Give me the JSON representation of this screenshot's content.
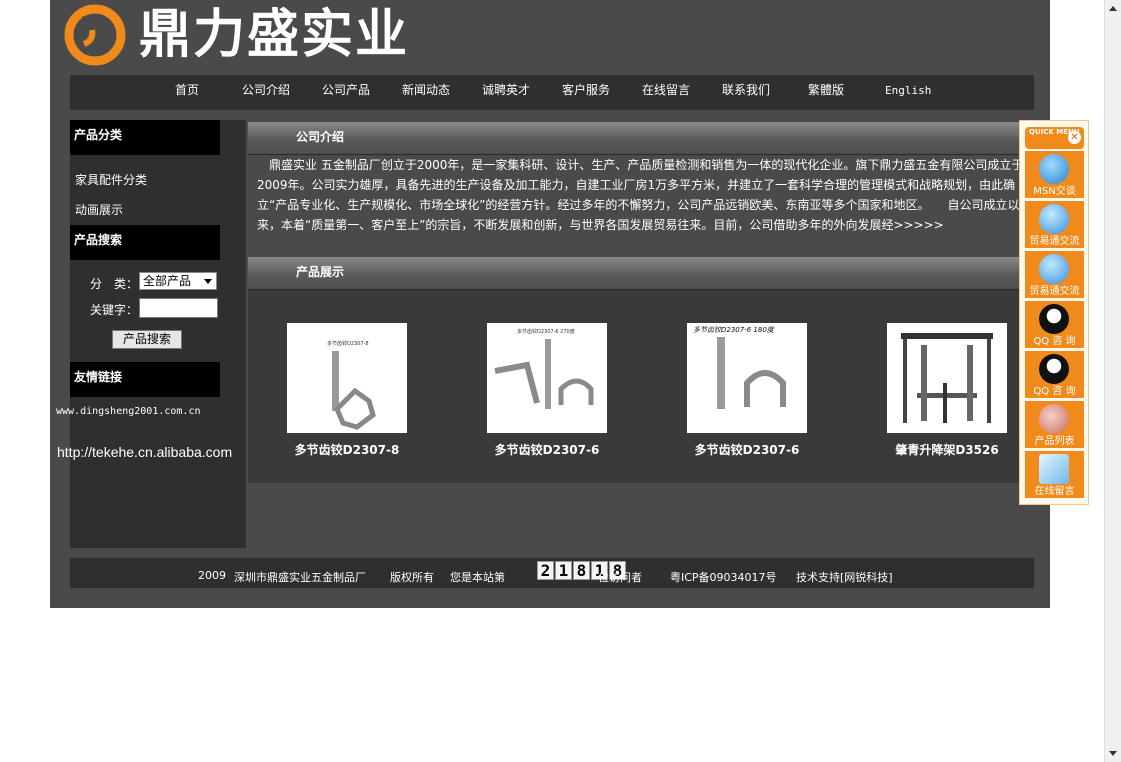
{
  "header": {
    "logo_text": "鼎力盛实业"
  },
  "nav": [
    "首页",
    "公司介绍",
    "公司产品",
    "新闻动态",
    "诚聘英才",
    "客户服务",
    "在线留言",
    "联系我们",
    "繁體版",
    "English"
  ],
  "sidebar": {
    "category_title": "产品分类",
    "categories": [
      "家具配件分类",
      "动画展示"
    ],
    "search_title": "产品搜索",
    "category_label": "分　类：",
    "category_value": "全部产品",
    "keyword_label": "关键字：",
    "search_button": "产品搜索",
    "links_title": "友情链接",
    "links": [
      "www.dingsheng2001.com.cn",
      "http://tekehe.cn.alibaba.com"
    ]
  },
  "about": {
    "title": "公司介绍",
    "text": "　鼎盛实业 五金制品厂创立于2000年，是一家集科研、设计、生产、产品质量检测和销售为一体的现代化企业。旗下鼎力盛五金有限公司成立于2009年。公司实力雄厚，具备先进的生产设备及加工能力，自建工业厂房1万多平方米，并建立了一套科学合理的管理模式和战略规划，由此确立“产品专业化、生产规模化、市场全球化”的经营方针。经过多年的不懈努力，公司产品远销欧美、东南亚等多个国家和地区。　　自公司成立以来，本着“质量第一、客户至上”的宗旨，不断发展和创新，与世界各国发展贸易往来。目前，公司借助多年的外向发展经>>>>>"
  },
  "products": {
    "title": "产品展示",
    "items": [
      {
        "name": "多节齿铰D2307-8",
        "img_label": "多节齿铰D2307-8"
      },
      {
        "name": "多节齿铰D2307-6",
        "img_label": "多节齿铰D2307-6 270度"
      },
      {
        "name": "多节齿铰D2307-6",
        "img_label": "多节齿铰D2307-6 180度"
      },
      {
        "name": "肇青升降架D3526",
        "img_label": ""
      }
    ]
  },
  "footer": {
    "year": "2009",
    "company": "深圳市鼎盛实业五金制品厂",
    "rights": "版权所有",
    "visitor_prefix": "您是本站第",
    "counter": [
      "2",
      "1",
      "8",
      "1",
      "8"
    ],
    "visitor_suffix": "位访问者",
    "icp": "粤ICP备09034017号",
    "support": "技术支持[网锐科技]"
  },
  "quick_menu": {
    "title": "QUICK MENU",
    "items": [
      "MSN交谈",
      "贸易通交流",
      "贸易通交流",
      "QQ 咨 询",
      "QQ 咨 询",
      "产品列表",
      "在线留言"
    ]
  },
  "colors": {
    "page_bg": "#4a4a4a",
    "panel_bg": "#2f2f2f",
    "logo_orange": "#f08a1a",
    "menu_orange": "#f08a1a"
  }
}
